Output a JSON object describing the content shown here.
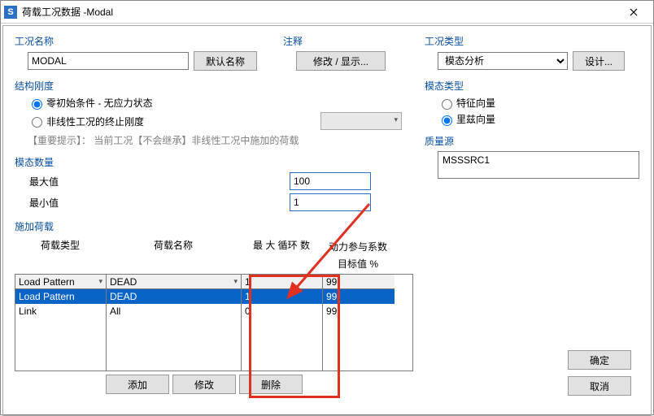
{
  "window": {
    "title": "荷载工况数据 -Modal"
  },
  "caseName": {
    "legend": "工况名称",
    "value": "MODAL",
    "defaultBtn": "默认名称"
  },
  "notes": {
    "legend": "注释",
    "btn": "修改 / 显示..."
  },
  "caseType": {
    "legend": "工况类型",
    "value": "模态分析",
    "designBtn": "设计..."
  },
  "stiffness": {
    "legend": "结构刚度",
    "opt1": "零初始条件 - 无应力状态",
    "opt2": "非线性工况的终止刚度",
    "hint": "【重要提示】：    当前工况【不会继承】非线性工况中施加的荷载"
  },
  "modalType": {
    "legend": "模态类型",
    "opt1": "特征向量",
    "opt2": "里兹向量"
  },
  "massSource": {
    "legend": "质量源",
    "value": "MSSSRC1"
  },
  "modeNum": {
    "legend": "模态数量",
    "maxLabel": "最大值",
    "maxVal": "100",
    "minLabel": "最小值",
    "minVal": "1"
  },
  "loads": {
    "legend": "施加荷载",
    "headers": {
      "type": "荷载类型",
      "name": "荷载名称",
      "cycles": "最 大 循环 数",
      "dynPart1": "动力参与系数",
      "dynPart2": "目标值 %"
    },
    "topRow": {
      "type": "Load Pattern",
      "name": "DEAD",
      "cycles": "1",
      "target": "99"
    },
    "rows": [
      {
        "type": "Load Pattern",
        "name": "DEAD",
        "cycles": "1",
        "target": "99"
      },
      {
        "type": "Link",
        "name": "All",
        "cycles": "0",
        "target": "99"
      }
    ],
    "addBtn": "添加",
    "modBtn": "修改",
    "delBtn": "删除"
  },
  "okBtn": "确定",
  "cancelBtn": "取消"
}
